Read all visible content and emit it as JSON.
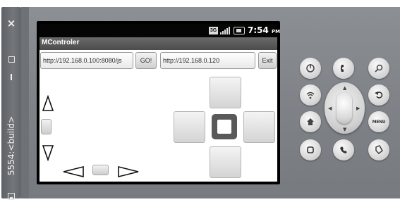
{
  "sidebar": {
    "close_glyph": "×",
    "window_title": "5554:<build>"
  },
  "statusbar": {
    "network_label": "3G",
    "time": "7:54",
    "time_suffix": "PM"
  },
  "app": {
    "title": "MControler",
    "url_left": "http://192.168.0.100:8080/js",
    "go_label": "GO!",
    "url_right": "http://192.168.0.120",
    "exit_label": "Exit"
  },
  "controls": {
    "up_glyph": "triangle-up-icon",
    "down_glyph": "triangle-down-icon",
    "left_glyph": "triangle-left-icon",
    "right_glyph": "triangle-right-icon"
  },
  "keys": {
    "menu_label": "MENU"
  },
  "colors": {
    "emulator_body": "#82868b",
    "screen_bezel": "#000000",
    "title_bar": "#555555",
    "sidebar": "#676b6f"
  }
}
